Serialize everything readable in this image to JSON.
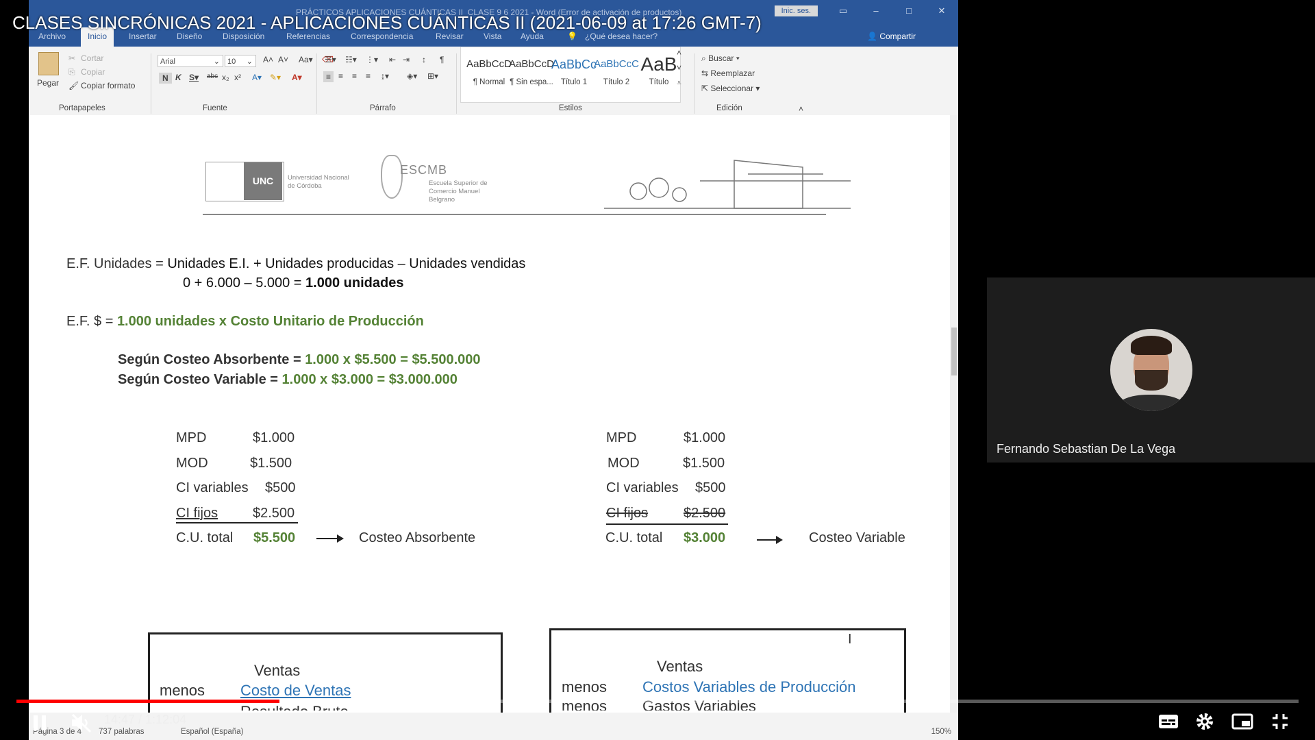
{
  "video": {
    "title": "CLASES SINCRÓNICAS 2021 - APLICACIONES CUÁNTICAS II (2021-06-09 at 17:26 GMT-7)",
    "time": "14:47 / 1:12:04",
    "progress": 0.205
  },
  "word": {
    "doc_title": "PRÁCTICOS APLICACIONES CUÁNTICAS II_CLASE 9 6 2021  -  Word (Error de activación de productos)",
    "signin": "Inic. ses.",
    "tabs": [
      "Archivo",
      "Inicio",
      "Insertar",
      "Diseño",
      "Disposición",
      "Referencias",
      "Correspondencia",
      "Revisar",
      "Vista",
      "Ayuda"
    ],
    "tell_me": "¿Qué desea hacer?",
    "share": "Compartir",
    "clipboard": {
      "paste": "Pegar",
      "cut": "Cortar",
      "copy": "Copiar",
      "format": "Copiar formato",
      "label": "Portapapeles"
    },
    "font": {
      "name": "Arial",
      "size": "10",
      "label": "Fuente"
    },
    "paragraph_label": "Párrafo",
    "styles": [
      {
        "sample": "AaBbCcD",
        "name": "¶ Normal"
      },
      {
        "sample": "AaBbCcD",
        "name": "¶ Sin espa..."
      },
      {
        "sample": "AaBbCc",
        "name": "Título 1"
      },
      {
        "sample": "AaBbCcC",
        "name": "Título 2"
      },
      {
        "sample": "AaB",
        "name": "Título"
      }
    ],
    "styles_label": "Estilos",
    "editing": {
      "find": "Buscar",
      "replace": "Reemplazar",
      "select": "Seleccionar",
      "label": "Edición"
    },
    "status": {
      "page": "Página 3 de 4",
      "words": "737 palabras",
      "lang": "Español (España)",
      "zoom": "150%"
    }
  },
  "doc": {
    "logo_unc": "UNC",
    "logo_unc_text": "Universidad Nacional de Córdoba",
    "logo_escmb": "ESCMB",
    "logo_escmb_text": "Escuela Superior de Comercio Manuel Belgrano",
    "ef_units_label": "E.F. Unidades = ",
    "ef_units_formula": "Unidades E.I. + Unidades producidas – Unidades vendidas",
    "ef_units_calc": "0 + 6.000 – 5.000 = ",
    "ef_units_result": "1.000 unidades",
    "ef_money_label": "E.F. $ = ",
    "ef_money_formula": "1.000 unidades x Costo Unitario de Producción",
    "absorbente_label": "Según Costeo Absorbente = ",
    "absorbente_value": "1.000 x $5.500 = $5.500.000",
    "variable_label": "Según Costeo Variable = ",
    "variable_value": "1.000 x $3.000 = $3.000.000",
    "left_costs": [
      {
        "k": "MPD",
        "v": "$1.000"
      },
      {
        "k": "MOD",
        "v": "$1.500"
      },
      {
        "k": "CI variables",
        "v": "$500"
      },
      {
        "k": "CI fijos",
        "v": "$2.500"
      },
      {
        "k": "C.U. total",
        "v": "$5.500"
      }
    ],
    "right_costs": [
      {
        "k": "MPD",
        "v": "$1.000"
      },
      {
        "k": "MOD",
        "v": "$1.500"
      },
      {
        "k": "CI variables",
        "v": "$500"
      },
      {
        "k": "CI fijos",
        "v": "$2.500"
      },
      {
        "k": "C.U. total",
        "v": "$3.000"
      }
    ],
    "left_method": "Costeo Absorbente",
    "right_method": "Costeo Variable",
    "left_box": {
      "ventas": "Ventas",
      "menos": "menos",
      "costo": "Costo de Ventas",
      "resultado": "Resultado Bruto"
    },
    "right_box": {
      "ventas": "Ventas",
      "menos1": "menos",
      "costo1": "Costos Variables de Producción",
      "menos2": "menos",
      "costo2": "Gastos Variables"
    }
  },
  "participant": {
    "name": "Fernando Sebastian De La Vega"
  },
  "colors": {
    "word_blue": "#2b579a",
    "green": "#548235",
    "link_blue": "#2e74b5",
    "progress_red": "#ff0000"
  }
}
